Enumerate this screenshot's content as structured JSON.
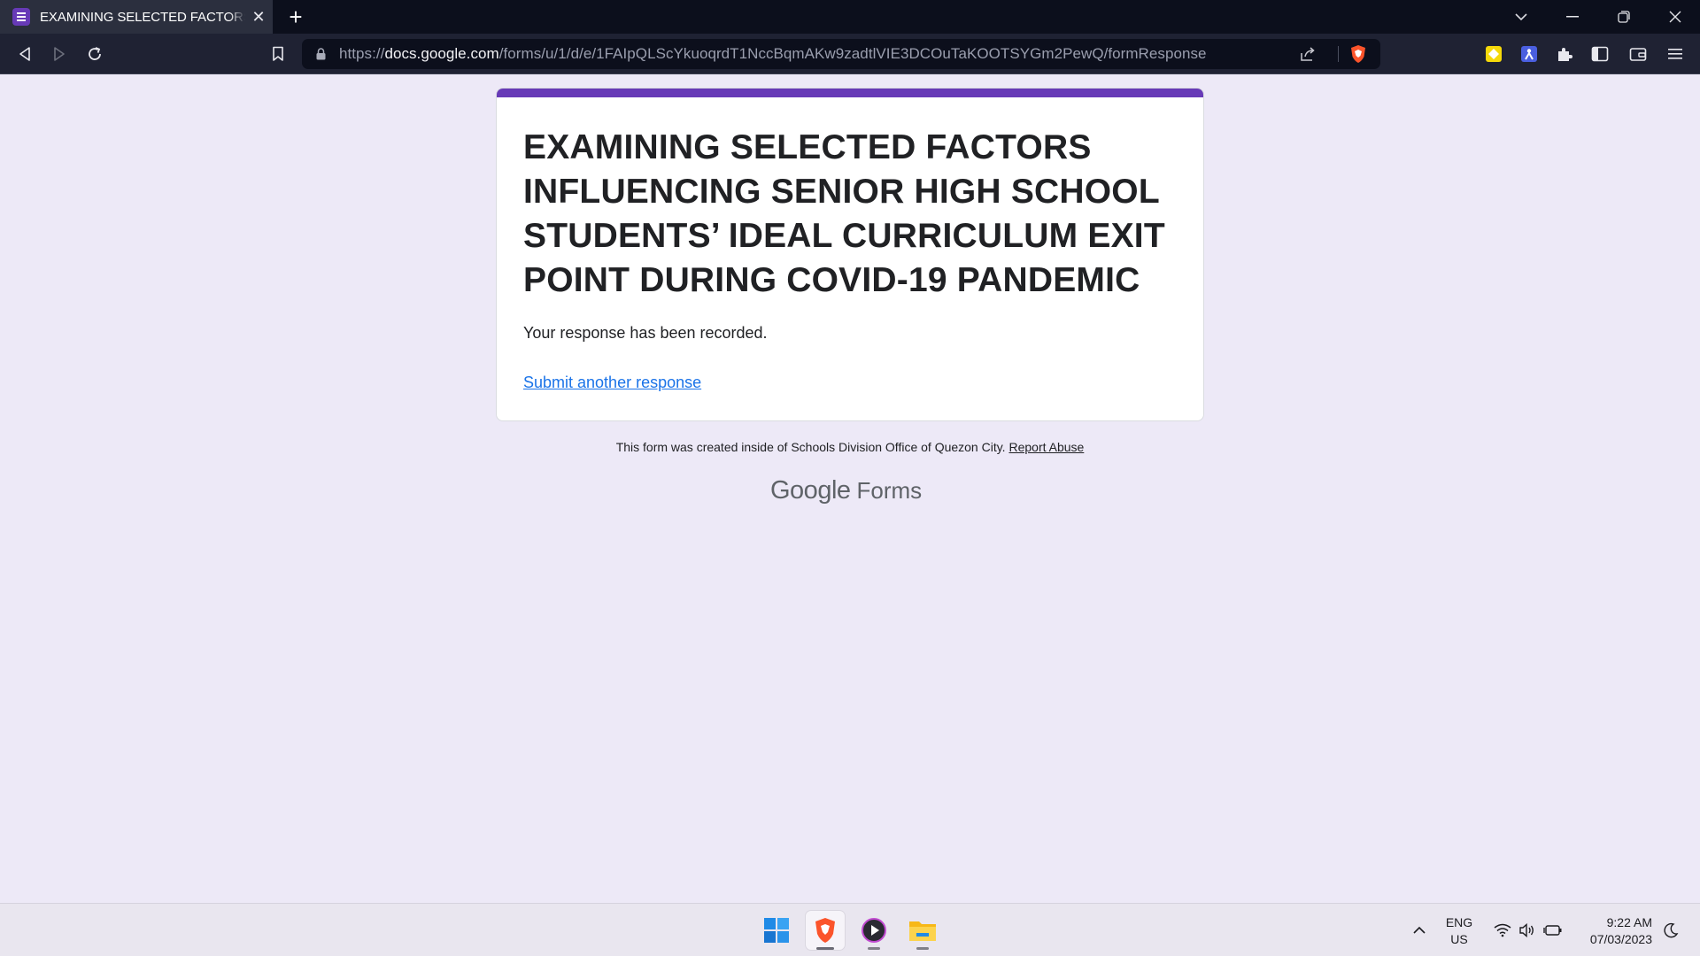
{
  "browser": {
    "tab_title": "EXAMINING SELECTED FACTORS INFLUENCING SENIOR HIGH SCHOOL STUDENTS",
    "tab_close": "✕",
    "new_tab": "+",
    "url_scheme": "https://",
    "url_host": "docs.google.com",
    "url_path": "/forms/u/1/d/e/1FAIpQLScYkuoqrdT1NccBqmAKw9zadtlVIE3DCOuTaKOOTSYGm2PewQ/formResponse"
  },
  "form": {
    "title": "EXAMINING SELECTED FACTORS INFLUENCING SENIOR HIGH SCHOOL STUDENTS’ IDEAL CURRICULUM EXIT POINT DURING COVID-19 PANDEMIC",
    "confirmation": "Your response has been recorded.",
    "submit_another": "Submit another response",
    "accent_color": "#673ab7",
    "link_color": "#1a73e8"
  },
  "footer": {
    "created_text": "This form was created inside of Schools Division Office of Quezon City.",
    "report_abuse": "Report Abuse",
    "brand_google": "Google",
    "brand_forms": "Forms"
  },
  "taskbar": {
    "apps": [
      "windows-start",
      "brave-browser",
      "media-player",
      "file-explorer"
    ],
    "lang_top": "ENG",
    "lang_bottom": "US",
    "time": "9:22 AM",
    "date": "07/03/2023"
  }
}
